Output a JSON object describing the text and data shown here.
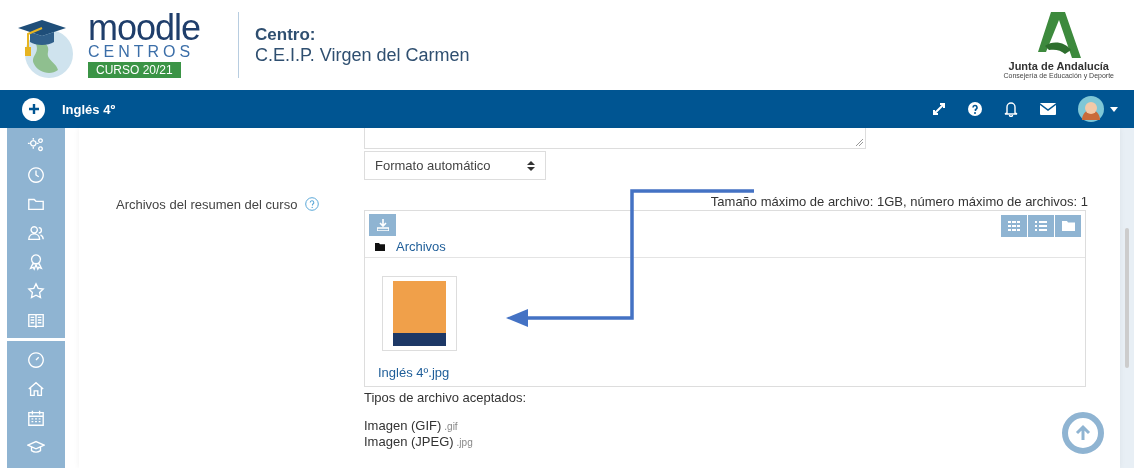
{
  "header": {
    "logo": {
      "name": "moodle",
      "subtitle": "CENTROS",
      "badge": "CURSO 20/21"
    },
    "centro_label": "Centro:",
    "centro_name": "C.E.I.P. Virgen del Carmen",
    "org_logo": {
      "name": "Junta de Andalucía",
      "subtitle": "Consejería de Educación y Deporte"
    }
  },
  "navbar": {
    "course_title": "Inglés 4º"
  },
  "form": {
    "format_select": {
      "value": "Formato automático"
    },
    "files_field": {
      "label": "Archivos del resumen del curso",
      "limits": "Tamaño máximo de archivo: 1GB, número máximo de archivos: 1",
      "path": "Archivos",
      "files": [
        {
          "name": "Inglés 4º.jpg"
        }
      ],
      "accepted_title": "Tipos de archivo aceptados:",
      "accepted_types": [
        {
          "name": "Imagen (GIF)",
          "ext": ".gif"
        },
        {
          "name": "Imagen (JPEG)",
          "ext": ".jpg"
        }
      ]
    }
  }
}
